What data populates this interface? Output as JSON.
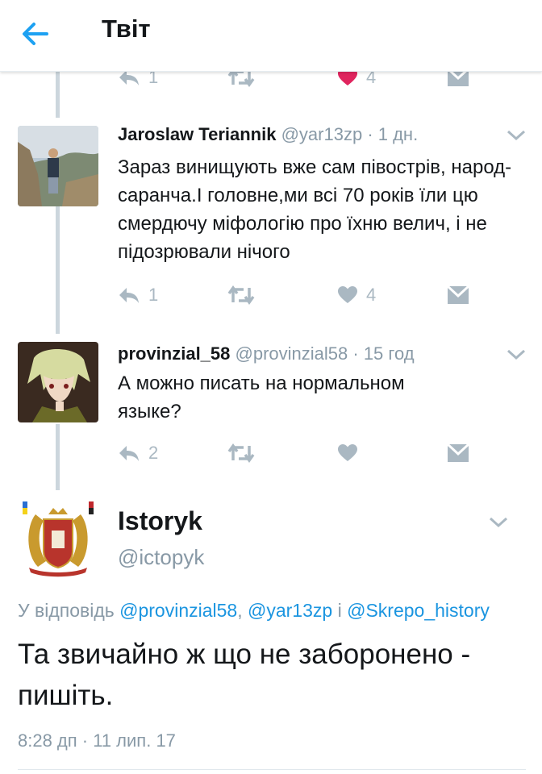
{
  "header": {
    "title": "Твіт"
  },
  "top_actions": {
    "reply_count": "1",
    "like_count": "4"
  },
  "tweets": [
    {
      "name": "Jaroslaw Teriannik",
      "handle": "@yar13zp",
      "time": "· 1 дн.",
      "text": "Зараз винищують вже сам півострів, народ-саранча.І головне,ми всі 70 років їли цю смердючу міфологію про їхню велич, і не підозрювали нічого",
      "reply_count": "1",
      "retweet_count": "",
      "like_count": "4"
    },
    {
      "name": "provinzial_58",
      "handle": "@provinzial58",
      "time": "· 15 год",
      "text": "А можно писать на нормальном языке?",
      "reply_count": "2",
      "retweet_count": "",
      "like_count": ""
    }
  ],
  "main_tweet": {
    "name": "Istoryk",
    "handle": "@ictopyk",
    "reply_prefix": "У відповідь",
    "reply_to": [
      "@provinzial58",
      "@yar13zp",
      "@Skrepo_history"
    ],
    "reply_sep_1": ",",
    "reply_sep_2": "і",
    "text": "Та звичайно ж що не заборонено - пишіть.",
    "timestamp": "8:28 дп · 11 лип. 17"
  },
  "colors": {
    "accent": "#1da1f2",
    "like_red": "#e0245e",
    "icon_gray": "#aab8c2",
    "text_gray": "#8899a6"
  },
  "icons": [
    "back-arrow-icon",
    "reply-icon",
    "retweet-icon",
    "heart-icon",
    "direct-message-icon",
    "chevron-down-icon"
  ]
}
